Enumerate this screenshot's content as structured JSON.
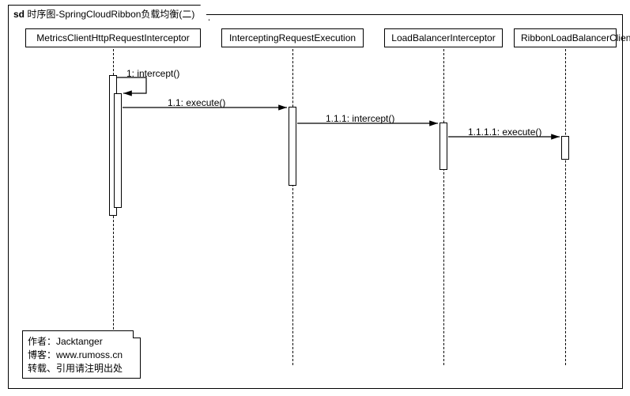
{
  "frame": {
    "prefix": "sd",
    "title": "时序图-SpringCloudRibbon负载均衡(二)"
  },
  "participants": {
    "p1": "MetricsClientHttpRequestInterceptor",
    "p2": "InterceptingRequestExecution",
    "p3": "LoadBalancerInterceptor",
    "p4": "RibbonLoadBalancerClient"
  },
  "messages": {
    "m1": "1: intercept()",
    "m2": "1.1: execute()",
    "m3": "1.1.1: intercept()",
    "m4": "1.1.1.1: execute()"
  },
  "note": {
    "line1": "作者：Jacktanger",
    "line2": "博客：www.rumoss.cn",
    "line3": "转载、引用请注明出处"
  },
  "chart_data": {
    "type": "table",
    "description": "UML sequence diagram",
    "participants": [
      "MetricsClientHttpRequestInterceptor",
      "InterceptingRequestExecution",
      "LoadBalancerInterceptor",
      "RibbonLoadBalancerClient"
    ],
    "messages": [
      {
        "seq": "1",
        "from": "MetricsClientHttpRequestInterceptor",
        "to": "MetricsClientHttpRequestInterceptor",
        "label": "intercept()",
        "self": true
      },
      {
        "seq": "1.1",
        "from": "MetricsClientHttpRequestInterceptor",
        "to": "InterceptingRequestExecution",
        "label": "execute()"
      },
      {
        "seq": "1.1.1",
        "from": "InterceptingRequestExecution",
        "to": "LoadBalancerInterceptor",
        "label": "intercept()"
      },
      {
        "seq": "1.1.1.1",
        "from": "LoadBalancerInterceptor",
        "to": "RibbonLoadBalancerClient",
        "label": "execute()"
      }
    ],
    "note": "作者：Jacktanger 博客：www.rumoss.cn 转载、引用请注明出处"
  }
}
